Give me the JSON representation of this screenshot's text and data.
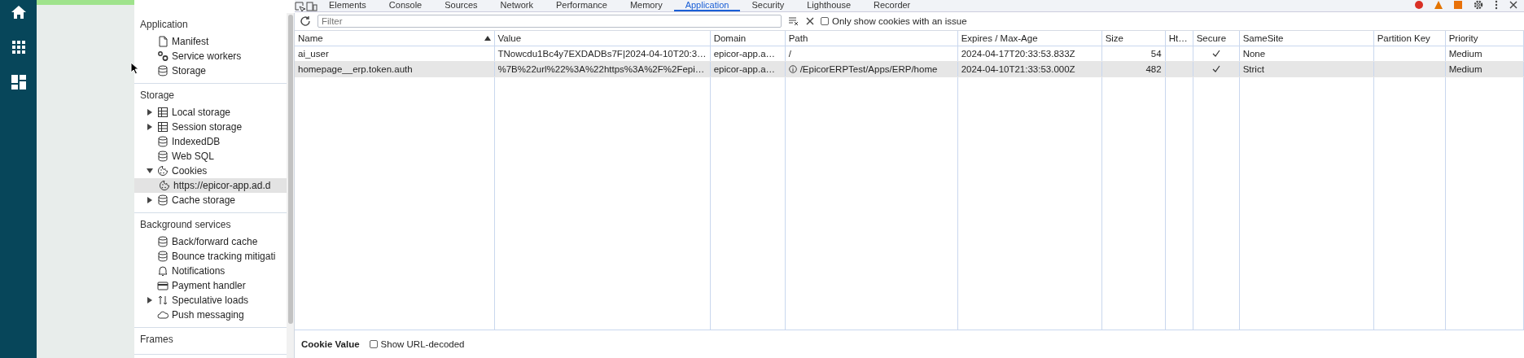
{
  "devtools": {
    "tabs": [
      {
        "label": "Elements",
        "selected": false
      },
      {
        "label": "Console",
        "selected": false
      },
      {
        "label": "Sources",
        "selected": false
      },
      {
        "label": "Network",
        "selected": false
      },
      {
        "label": "Performance",
        "selected": false
      },
      {
        "label": "Memory",
        "selected": false
      },
      {
        "label": "Application",
        "selected": true
      },
      {
        "label": "Security",
        "selected": false
      },
      {
        "label": "Lighthouse",
        "selected": false
      },
      {
        "label": "Recorder",
        "selected": false
      }
    ],
    "sidebar": {
      "sections": [
        {
          "title": "Application",
          "items": [
            {
              "label": "Manifest",
              "kind": "leaf",
              "selected": false
            },
            {
              "label": "Service workers",
              "kind": "leaf",
              "selected": false
            },
            {
              "label": "Storage",
              "kind": "leaf",
              "selected": false
            }
          ]
        },
        {
          "title": "Storage",
          "items": [
            {
              "label": "Local storage",
              "kind": "expandable",
              "expanded": false,
              "selected": false
            },
            {
              "label": "Session storage",
              "kind": "expandable",
              "expanded": false,
              "selected": false
            },
            {
              "label": "IndexedDB",
              "kind": "leaf",
              "selected": false
            },
            {
              "label": "Web SQL",
              "kind": "leaf",
              "selected": false
            },
            {
              "label": "Cookies",
              "kind": "expandable",
              "expanded": true,
              "selected": false,
              "children": [
                {
                  "label": "https://epicor-app.ad.d",
                  "selected": true
                }
              ]
            },
            {
              "label": "Cache storage",
              "kind": "expandable",
              "expanded": false,
              "selected": false
            }
          ]
        },
        {
          "title": "Background services",
          "items": [
            {
              "label": "Back/forward cache",
              "kind": "leaf",
              "selected": false
            },
            {
              "label": "Bounce tracking mitigati",
              "kind": "leaf",
              "selected": false
            },
            {
              "label": "Notifications",
              "kind": "leaf",
              "selected": false
            },
            {
              "label": "Payment handler",
              "kind": "leaf",
              "selected": false
            },
            {
              "label": "Speculative loads",
              "kind": "expandable",
              "expanded": false,
              "selected": false
            },
            {
              "label": "Push messaging",
              "kind": "leaf",
              "selected": false
            }
          ]
        },
        {
          "title": "Frames"
        }
      ]
    },
    "toolbar": {
      "filter": {
        "placeholder": "Filter"
      },
      "issues_only": {
        "label": "Only show cookies with an issue",
        "checked": false
      }
    },
    "table": {
      "columns": [
        {
          "label": "Name",
          "sorted": true
        },
        {
          "label": "Value",
          "sorted": false
        },
        {
          "label": "Domain",
          "sorted": false
        },
        {
          "label": "Path",
          "sorted": false
        },
        {
          "label": "Expires / Max-Age",
          "sorted": false
        },
        {
          "label": "Size",
          "sorted": false
        },
        {
          "label": "Ht…",
          "sorted": false
        },
        {
          "label": "Secure",
          "sorted": false
        },
        {
          "label": "SameSite",
          "sorted": false
        },
        {
          "label": "Partition Key",
          "sorted": false
        },
        {
          "label": "Priority",
          "sorted": false
        }
      ],
      "rows": [
        {
          "name": "ai_user",
          "value": "TNowcdu1Bc4y7EXDADBs7F|2024-04-10T20:3…",
          "domain": "epicor-app.a…",
          "path": "/",
          "path_issue": false,
          "expires": "2024-04-17T20:33:53.833Z",
          "size": "54",
          "http_only": false,
          "secure": true,
          "samesite": "None",
          "priority": "Medium",
          "selected": false
        },
        {
          "name": "homepage__erp.token.auth",
          "value": "%7B%22url%22%3A%22https%3A%2F%2Fepi…",
          "domain": "epicor-app.a…",
          "path": "/EpicorERPTest/Apps/ERP/home",
          "path_issue": true,
          "expires": "2024-04-10T21:33:53.000Z",
          "size": "482",
          "http_only": false,
          "secure": true,
          "samesite": "Strict",
          "priority": "Medium",
          "selected": true
        }
      ]
    },
    "details_bar": {
      "title": "Cookie Value",
      "url_decoded": {
        "label": "Show URL-decoded",
        "checked": false
      }
    }
  }
}
